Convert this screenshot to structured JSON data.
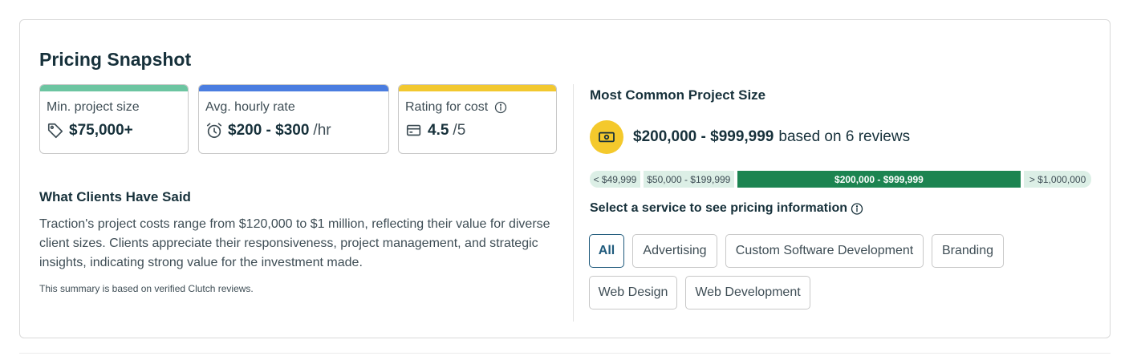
{
  "title": "Pricing Snapshot",
  "stats": [
    {
      "label": "Min. project size",
      "value": "$75,000+",
      "unit": "",
      "icon": "tag-icon",
      "color": "#6cc5a1"
    },
    {
      "label": "Avg. hourly rate",
      "value": "$200 - $300",
      "unit": "/hr",
      "icon": "alarm-clock-icon",
      "color": "#4a7de0"
    },
    {
      "label": "Rating for cost",
      "value": "4.5",
      "unit": "/5",
      "icon": "wallet-icon",
      "color": "#f2c82f"
    }
  ],
  "clients": {
    "heading": "What Clients Have Said",
    "summary": "Traction's project costs range from $120,000 to $1 million, reflecting their value for diverse client sizes. Clients appreciate their responsiveness, project management, and strategic insights, indicating strong value for the investment made.",
    "note": "This summary is based on verified Clutch reviews."
  },
  "most_common": {
    "heading": "Most Common Project Size",
    "range": "$200,000 - $999,999",
    "reviews": "based on 6 reviews",
    "icon": "money-icon",
    "scale": [
      {
        "label": "< $49,999",
        "active": false
      },
      {
        "label": "$50,000 - $199,999",
        "active": false
      },
      {
        "label": "$200,000 - $999,999",
        "active": true
      },
      {
        "label": "> $1,000,000",
        "active": false
      }
    ]
  },
  "services": {
    "heading": "Select a service to see pricing information",
    "options": [
      "All",
      "Advertising",
      "Custom Software Development",
      "Branding",
      "Web Design",
      "Web Development"
    ],
    "selected": "All"
  },
  "colors": {
    "accent": "#1f5a7c",
    "green": "#1c8451",
    "light_green": "#dcefe6",
    "yellow": "#f4c92c"
  }
}
